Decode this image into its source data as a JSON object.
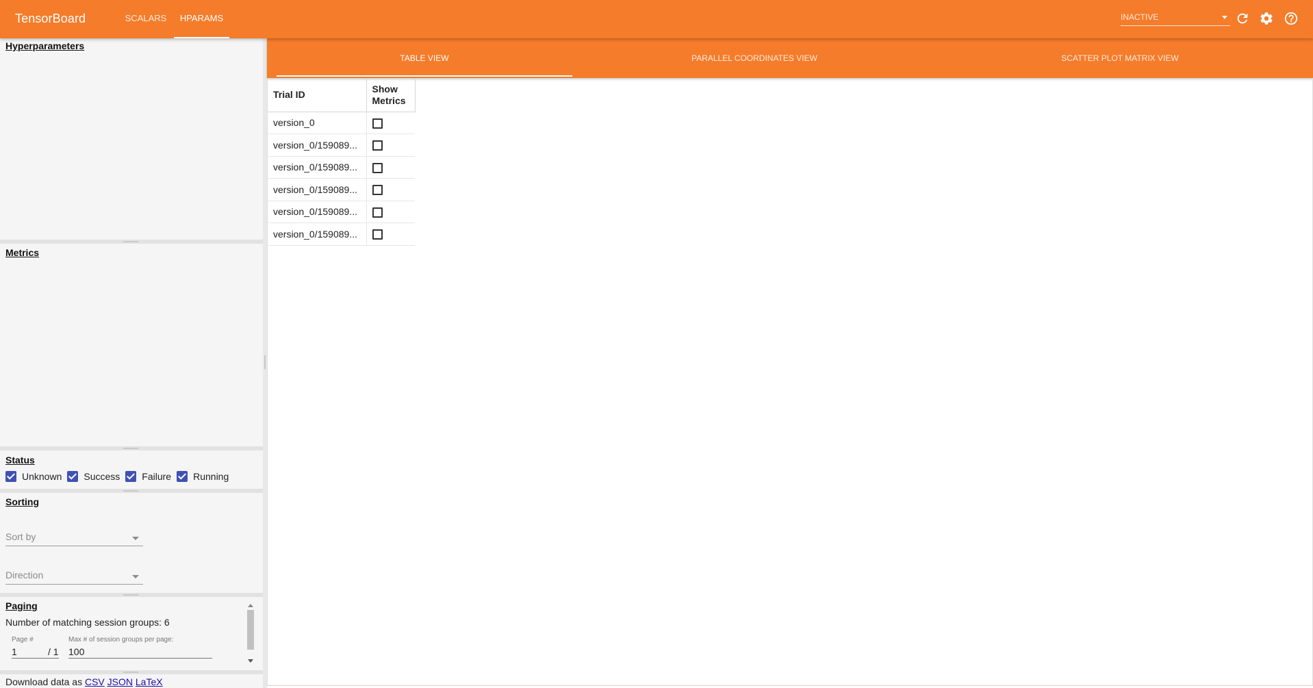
{
  "toolbar": {
    "brand": "TensorBoard",
    "tabs": [
      {
        "label": "SCALARS",
        "active": false
      },
      {
        "label": "HPARAMS",
        "active": true
      }
    ],
    "run_selector": {
      "value": "INACTIVE"
    },
    "icons": [
      "reload-icon",
      "settings-gear-icon",
      "help-icon"
    ],
    "color": "#f57c2a"
  },
  "sidebar": {
    "hyperparameters_title": "Hyperparameters",
    "metrics_title": "Metrics",
    "status": {
      "title": "Status",
      "options": [
        {
          "label": "Unknown",
          "checked": true
        },
        {
          "label": "Success",
          "checked": true
        },
        {
          "label": "Failure",
          "checked": true
        },
        {
          "label": "Running",
          "checked": true
        }
      ]
    },
    "sorting": {
      "title": "Sorting",
      "sort_by_placeholder": "Sort by",
      "direction_placeholder": "Direction"
    },
    "paging": {
      "title": "Paging",
      "matching_text": "Number of matching session groups: 6",
      "page_label": "Page #",
      "page_value": "1",
      "of_pages": "/ 1",
      "max_label": "Max # of session groups per page:",
      "max_value": "100"
    },
    "download": {
      "prefix": "Download data as",
      "formats": [
        "CSV",
        "JSON",
        "LaTeX"
      ]
    }
  },
  "main": {
    "view_tabs": [
      {
        "label": "TABLE VIEW",
        "active": true
      },
      {
        "label": "PARALLEL COORDINATES VIEW",
        "active": false
      },
      {
        "label": "SCATTER PLOT MATRIX VIEW",
        "active": false
      }
    ],
    "table": {
      "headers": [
        "Trial ID",
        "Show Metrics"
      ],
      "rows": [
        {
          "trial_id": "version_0",
          "show_metrics": false
        },
        {
          "trial_id": "version_0/159089...",
          "show_metrics": false
        },
        {
          "trial_id": "version_0/159089...",
          "show_metrics": false
        },
        {
          "trial_id": "version_0/159089...",
          "show_metrics": false
        },
        {
          "trial_id": "version_0/159089...",
          "show_metrics": false
        },
        {
          "trial_id": "version_0/159089...",
          "show_metrics": false
        }
      ]
    }
  }
}
